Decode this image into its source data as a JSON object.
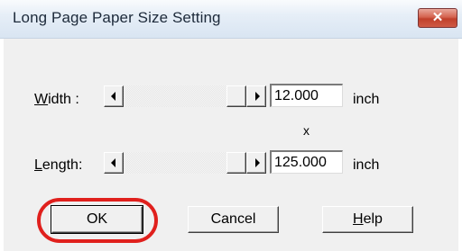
{
  "window": {
    "title": "Long Page Paper Size Setting",
    "close_glyph": "✕",
    "close_icon": "close-icon"
  },
  "width_row": {
    "label_mnemonic": "W",
    "label_rest": "idth :",
    "value": "12.000",
    "unit": "inch"
  },
  "separator": "x",
  "length_row": {
    "label_mnemonic": "L",
    "label_rest": "ength:",
    "value": "125.000",
    "unit": "inch"
  },
  "buttons": {
    "ok": "OK",
    "cancel": "Cancel",
    "help_mnemonic": "H",
    "help_rest": "elp"
  },
  "icons": {
    "scroll_left": "arrow-left-icon",
    "scroll_right": "arrow-right-icon"
  },
  "colors": {
    "highlight": "#e0201d",
    "close_button": "#c7442f"
  }
}
